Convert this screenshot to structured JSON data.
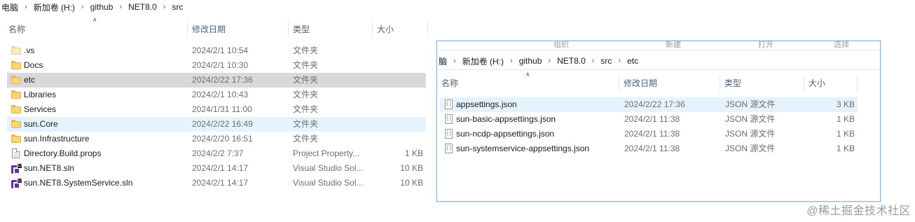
{
  "left": {
    "breadcrumb": [
      "电脑",
      "新加卷 (H:)",
      "github",
      "NET8.0",
      "src"
    ],
    "columns": {
      "name": "名称",
      "date": "修改日期",
      "type": "类型",
      "size": "大小"
    },
    "rows": [
      {
        "icon": "folder-light-icon",
        "name": ".vs",
        "date": "2024/2/1 10:54",
        "type": "文件夹",
        "size": ""
      },
      {
        "icon": "folder-icon",
        "name": "Docs",
        "date": "2024/2/1 10:30",
        "type": "文件夹",
        "size": ""
      },
      {
        "icon": "folder-icon",
        "name": "etc",
        "date": "2024/2/22 17:36",
        "type": "文件夹",
        "size": "",
        "state": "selected"
      },
      {
        "icon": "folder-icon",
        "name": "Libraries",
        "date": "2024/2/1 10:43",
        "type": "文件夹",
        "size": ""
      },
      {
        "icon": "folder-icon",
        "name": "Services",
        "date": "2024/1/31 11:00",
        "type": "文件夹",
        "size": ""
      },
      {
        "icon": "folder-icon",
        "name": "sun.Core",
        "date": "2024/2/22 16:49",
        "type": "文件夹",
        "size": "",
        "state": "hover"
      },
      {
        "icon": "folder-icon",
        "name": "sun.Infrastructure",
        "date": "2024/2/20 16:51",
        "type": "文件夹",
        "size": ""
      },
      {
        "icon": "document-icon",
        "name": "Directory.Build.props",
        "date": "2024/2/2 7:37",
        "type": "Project Property...",
        "size": "1 KB"
      },
      {
        "icon": "visual-studio-solution-icon",
        "name": "sun.NET8.sln",
        "date": "2024/2/1 14:17",
        "type": "Visual Studio Sol...",
        "size": "10 KB"
      },
      {
        "icon": "visual-studio-solution-icon",
        "name": "sun.NET8.SystemService.sln",
        "date": "2024/2/1 14:17",
        "type": "Visual Studio Sol...",
        "size": "10 KB"
      }
    ]
  },
  "right": {
    "ribbon_hints": [
      "组织",
      "新建",
      "打开",
      "选择"
    ],
    "breadcrumb": [
      "脑",
      "新加卷 (H:)",
      "github",
      "NET8.0",
      "src",
      "etc"
    ],
    "columns": {
      "name": "名称",
      "date": "修改日期",
      "type": "类型",
      "size": "大小"
    },
    "rows": [
      {
        "icon": "json-file-icon",
        "name": "appsettings.json",
        "date": "2024/2/22 17:36",
        "type": "JSON 源文件",
        "size": "3 KB",
        "state": "hover"
      },
      {
        "icon": "json-file-icon",
        "name": "sun-basic-appsettings.json",
        "date": "2024/2/1 11:38",
        "type": "JSON 源文件",
        "size": "1 KB"
      },
      {
        "icon": "json-file-icon",
        "name": "sun-ncdp-appsettings.json",
        "date": "2024/2/1 11:38",
        "type": "JSON 源文件",
        "size": "1 KB"
      },
      {
        "icon": "json-file-icon",
        "name": "sun-systemservice-appsettings.json",
        "date": "2024/2/1 11:38",
        "type": "JSON 源文件",
        "size": "1 KB"
      }
    ]
  },
  "watermark": "@稀土掘金技术社区"
}
